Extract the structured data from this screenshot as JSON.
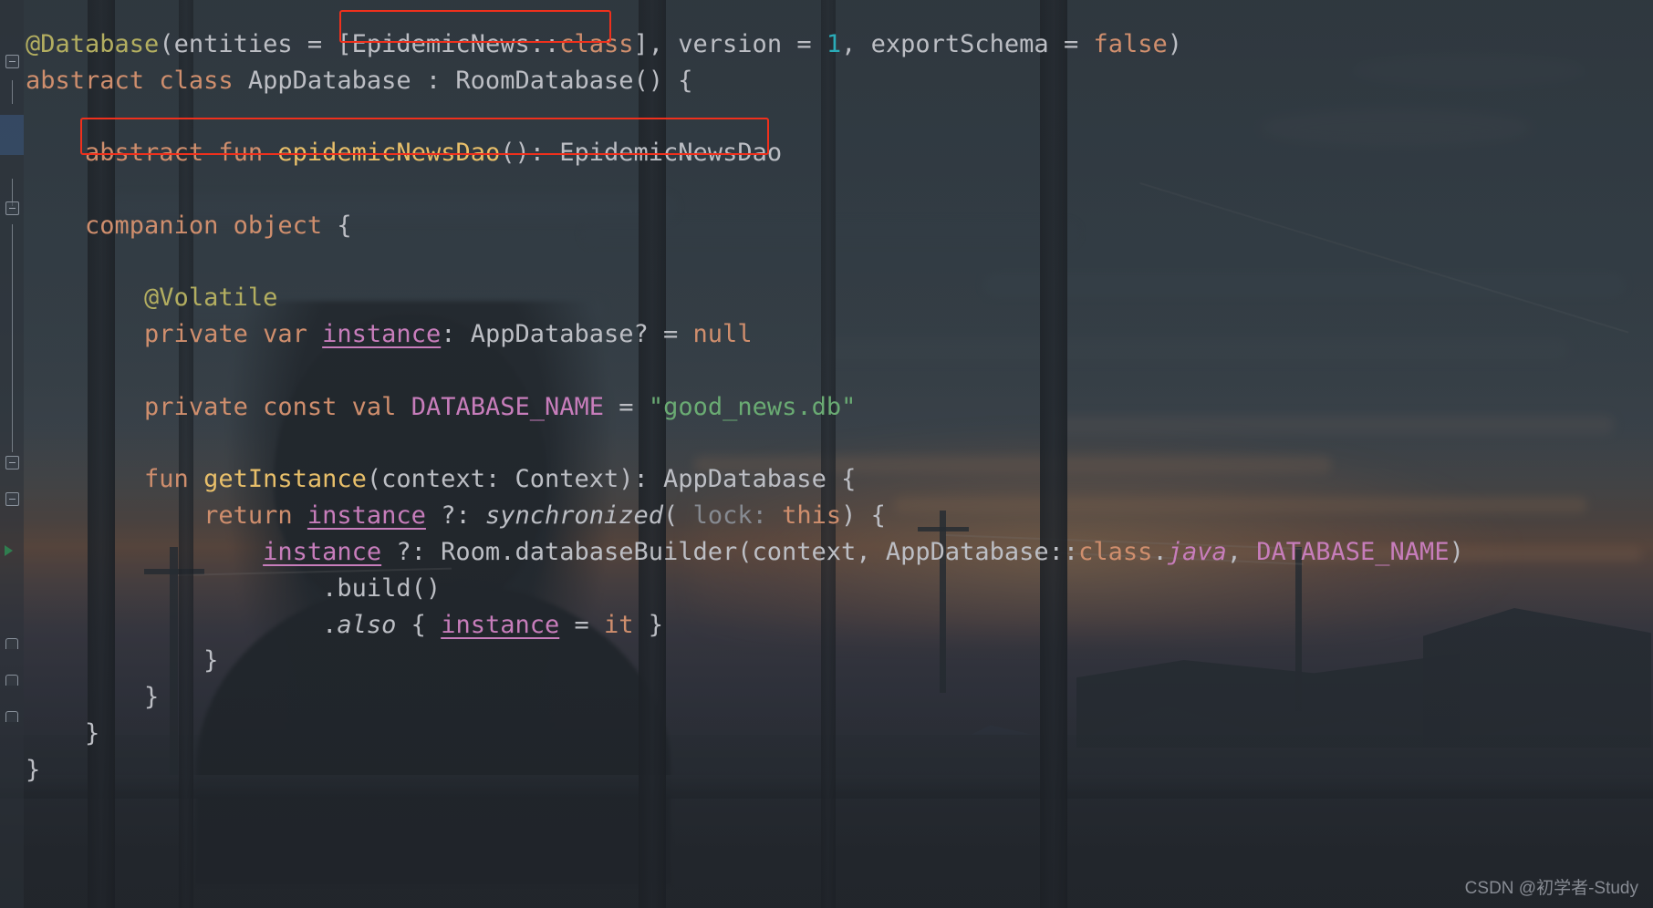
{
  "editor": {
    "language": "Kotlin",
    "font_size_px": 27,
    "line_height_px": 39.8,
    "background_theme": "dark-with-wallpaper",
    "colors": {
      "keyword": "#cf8e6d",
      "identifier": "#bcbec4",
      "annotation": "#b3ae60",
      "function_declaration": "#e8bf6a",
      "property": "#c77dbb",
      "number": "#2aacb8",
      "string": "#6aab73",
      "named_parameter": "#56a8f5",
      "dimmed": "#868a91",
      "annotation_box": "#f0301c",
      "gutter": "#8a929c"
    }
  },
  "code_lines": [
    {
      "id": "line-0",
      "text": "",
      "tokens": []
    },
    {
      "id": "line-1",
      "text": "@Database(entities = [EpidemicNews::class], version = 1, exportSchema = false)",
      "tokens": [
        {
          "t": "@Database",
          "c": "t-anno"
        },
        {
          "t": "(entities = [",
          "c": "t-plain"
        },
        {
          "t": "EpidemicNews",
          "c": "t-plain"
        },
        {
          "t": "::",
          "c": "t-plain"
        },
        {
          "t": "class",
          "c": "t-def"
        },
        {
          "t": "], version = ",
          "c": "t-plain"
        },
        {
          "t": "1",
          "c": "t-num"
        },
        {
          "t": ", exportSchema = ",
          "c": "t-plain"
        },
        {
          "t": "false",
          "c": "t-def"
        },
        {
          "t": ")",
          "c": "t-plain"
        }
      ]
    },
    {
      "id": "line-2",
      "text": "abstract class AppDatabase : RoomDatabase() {",
      "tokens": [
        {
          "t": "abstract",
          "c": "t-def"
        },
        {
          "t": " ",
          "c": "t-plain"
        },
        {
          "t": "class",
          "c": "t-def"
        },
        {
          "t": " AppDatabase : RoomDatabase() {",
          "c": "t-plain"
        }
      ]
    },
    {
      "id": "line-3",
      "text": "",
      "tokens": []
    },
    {
      "id": "line-4",
      "text": "    abstract fun epidemicNewsDao(): EpidemicNewsDao",
      "tokens": [
        {
          "t": "    ",
          "c": "t-plain"
        },
        {
          "t": "abstract",
          "c": "t-def"
        },
        {
          "t": " ",
          "c": "t-plain"
        },
        {
          "t": "fun",
          "c": "t-def"
        },
        {
          "t": " ",
          "c": "t-plain"
        },
        {
          "t": "epidemicNewsDao",
          "c": "t-func"
        },
        {
          "t": "(): EpidemicNewsDao",
          "c": "t-plain"
        }
      ]
    },
    {
      "id": "line-5",
      "text": "",
      "tokens": []
    },
    {
      "id": "line-6",
      "text": "    companion object {",
      "tokens": [
        {
          "t": "    ",
          "c": "t-plain"
        },
        {
          "t": "companion object",
          "c": "t-def"
        },
        {
          "t": " {",
          "c": "t-plain"
        }
      ]
    },
    {
      "id": "line-7",
      "text": "",
      "tokens": []
    },
    {
      "id": "line-8",
      "text": "        @Volatile",
      "tokens": [
        {
          "t": "        ",
          "c": "t-plain"
        },
        {
          "t": "@Volatile",
          "c": "t-anno"
        }
      ]
    },
    {
      "id": "line-9",
      "text": "        private var instance: AppDatabase? = null",
      "tokens": [
        {
          "t": "        ",
          "c": "t-plain"
        },
        {
          "t": "private",
          "c": "t-def"
        },
        {
          "t": " ",
          "c": "t-plain"
        },
        {
          "t": "var",
          "c": "t-def"
        },
        {
          "t": " ",
          "c": "t-plain"
        },
        {
          "t": "instance",
          "c": "t-field underline"
        },
        {
          "t": ": AppDatabase? = ",
          "c": "t-plain"
        },
        {
          "t": "null",
          "c": "t-def"
        }
      ]
    },
    {
      "id": "line-10",
      "text": "",
      "tokens": []
    },
    {
      "id": "line-11",
      "text": "        private const val DATABASE_NAME = \"good_news.db\"",
      "tokens": [
        {
          "t": "        ",
          "c": "t-plain"
        },
        {
          "t": "private",
          "c": "t-def"
        },
        {
          "t": " ",
          "c": "t-plain"
        },
        {
          "t": "const",
          "c": "t-def"
        },
        {
          "t": " ",
          "c": "t-plain"
        },
        {
          "t": "val",
          "c": "t-def"
        },
        {
          "t": " ",
          "c": "t-plain"
        },
        {
          "t": "DATABASE_NAME",
          "c": "t-field"
        },
        {
          "t": " = ",
          "c": "t-plain"
        },
        {
          "t": "\"good_news.db\"",
          "c": "t-str"
        }
      ]
    },
    {
      "id": "line-12",
      "text": "",
      "tokens": []
    },
    {
      "id": "line-13",
      "text": "        fun getInstance(context: Context): AppDatabase {",
      "tokens": [
        {
          "t": "        ",
          "c": "t-plain"
        },
        {
          "t": "fun",
          "c": "t-def"
        },
        {
          "t": " ",
          "c": "t-plain"
        },
        {
          "t": "getInstance",
          "c": "t-func"
        },
        {
          "t": "(context: Context): AppDatabase {",
          "c": "t-plain"
        }
      ]
    },
    {
      "id": "line-14",
      "text": "            return instance ?: synchronized( lock: this) {",
      "tokens": [
        {
          "t": "            ",
          "c": "t-plain"
        },
        {
          "t": "return",
          "c": "t-def"
        },
        {
          "t": " ",
          "c": "t-plain"
        },
        {
          "t": "instance",
          "c": "t-field underline"
        },
        {
          "t": " ?: ",
          "c": "t-plain"
        },
        {
          "t": "synchronized",
          "c": "t-plain t-italic"
        },
        {
          "t": "( ",
          "c": "t-plain"
        },
        {
          "t": "lock:",
          "c": "t-dim"
        },
        {
          "t": " ",
          "c": "t-plain"
        },
        {
          "t": "this",
          "c": "t-def"
        },
        {
          "t": ") {",
          "c": "t-plain"
        }
      ]
    },
    {
      "id": "line-15",
      "text": "                instance ?: Room.databaseBuilder(context, AppDatabase::class.java, DATABASE_NAME)",
      "tokens": [
        {
          "t": "                ",
          "c": "t-plain"
        },
        {
          "t": "instance",
          "c": "t-field underline"
        },
        {
          "t": " ?: Room.databaseBuilder(context, AppDatabase",
          "c": "t-plain"
        },
        {
          "t": "::",
          "c": "t-plain"
        },
        {
          "t": "class",
          "c": "t-def"
        },
        {
          "t": ".",
          "c": "t-plain"
        },
        {
          "t": "java",
          "c": "t-field t-italic"
        },
        {
          "t": ", ",
          "c": "t-plain"
        },
        {
          "t": "DATABASE_NAME",
          "c": "t-field"
        },
        {
          "t": ")",
          "c": "t-plain"
        }
      ]
    },
    {
      "id": "line-16",
      "text": "                    .build()",
      "tokens": [
        {
          "t": "                    .build()",
          "c": "t-plain"
        }
      ]
    },
    {
      "id": "line-17",
      "text": "                    .also { instance = it }",
      "tokens": [
        {
          "t": "                    .",
          "c": "t-plain"
        },
        {
          "t": "also",
          "c": "t-plain t-italic"
        },
        {
          "t": " { ",
          "c": "t-plain"
        },
        {
          "t": "instance",
          "c": "t-field underline"
        },
        {
          "t": " = ",
          "c": "t-plain"
        },
        {
          "t": "it",
          "c": "t-def"
        },
        {
          "t": " }",
          "c": "t-plain"
        }
      ]
    },
    {
      "id": "line-18",
      "text": "            }",
      "tokens": [
        {
          "t": "            }",
          "c": "t-plain"
        }
      ]
    },
    {
      "id": "line-19",
      "text": "        }",
      "tokens": [
        {
          "t": "        }",
          "c": "t-plain"
        }
      ]
    },
    {
      "id": "line-20",
      "text": "    }",
      "tokens": [
        {
          "t": "    }",
          "c": "t-plain"
        }
      ]
    },
    {
      "id": "line-21",
      "text": "}",
      "tokens": [
        {
          "t": "}",
          "c": "t-plain"
        }
      ]
    }
  ],
  "annotations": [
    {
      "name": "entity-class-highlight",
      "target": "EpidemicNews::class",
      "color": "#f0301c"
    },
    {
      "name": "dao-declaration-highlight",
      "target": "abstract fun epidemicNewsDao(): EpidemicNewsDao",
      "color": "#f0301c"
    }
  ],
  "gutter": {
    "icons": [
      {
        "name": "fold-collapse-icon",
        "line": 2
      },
      {
        "name": "fold-collapse-icon",
        "line": 6
      },
      {
        "name": "fold-collapse-icon",
        "line": 13
      },
      {
        "name": "fold-collapse-icon",
        "line": 14
      },
      {
        "name": "run-gutter-icon",
        "line": 15
      },
      {
        "name": "block-end-icon",
        "line": 18
      },
      {
        "name": "block-end-icon",
        "line": 19
      },
      {
        "name": "block-end-icon",
        "line": 20
      }
    ]
  },
  "watermark": {
    "text": "CSDN @初学者-Study"
  }
}
